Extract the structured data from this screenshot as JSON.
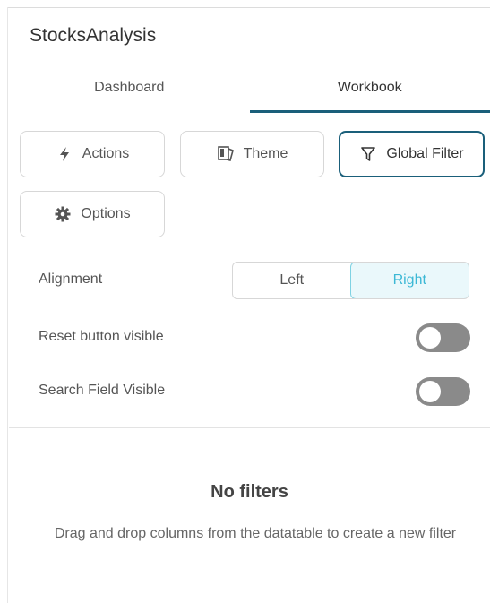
{
  "panel": {
    "title": "StocksAnalysis",
    "tabs": [
      {
        "label": "Dashboard",
        "active": false
      },
      {
        "label": "Workbook",
        "active": true
      }
    ],
    "buttons": {
      "actions": "Actions",
      "theme": "Theme",
      "global_filter": "Global Filter",
      "options": "Options"
    },
    "selected_button": "Global Filter",
    "accent_color": "#1a5f7a"
  },
  "settings": {
    "alignment": {
      "label": "Alignment",
      "options": [
        "Left",
        "Right"
      ],
      "selected": "Right"
    },
    "reset_button_visible": {
      "label": "Reset button visible",
      "value": false
    },
    "search_field_visible": {
      "label": "Search Field Visible",
      "value": false
    }
  },
  "empty_state": {
    "title": "No filters",
    "description": "Drag and drop columns from the datatable to create a new filter"
  },
  "icons": {
    "actions": "lightning-icon",
    "theme": "theme-icon",
    "global_filter": "filter-icon",
    "options": "gear-icon"
  }
}
